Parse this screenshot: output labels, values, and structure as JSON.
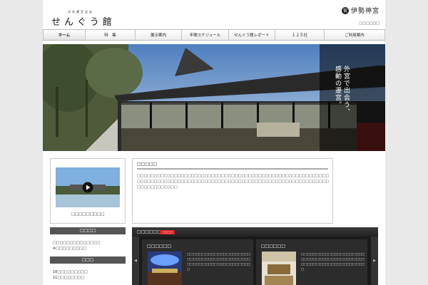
{
  "header": {
    "logo_sub": "式年遷宮記念",
    "logo_main": "せんぐう館",
    "ise_emblem": "宮",
    "ise_logo_text": "伊勢神宮",
    "top_link": "□□□□□□"
  },
  "nav": {
    "items": [
      {
        "label": "ホーム"
      },
      {
        "label": "特　集"
      },
      {
        "label": "展示案内"
      },
      {
        "label": "年間スケジュール"
      },
      {
        "label": "せんぐう館レポート"
      },
      {
        "label": "１２５社"
      },
      {
        "label": "ご利用案内"
      }
    ]
  },
  "hero": {
    "line1": "外宮で出会う、",
    "line2": "感動の遷宮。"
  },
  "video": {
    "caption": "□□□□□□□□□"
  },
  "notice": {
    "title": "□□□□□",
    "body": "□□□□□□□□□□□□□□□□□□□□□□□□□□□□□□□□□□□□□□□□□□□□□□□□□□□□□□□□□□□□□□□□□□□□□□□□□□□□□□□□□□□□□□□□□□□□□□□□□□□□□□□□□□□□□□□□□□□□□□□□□□□□□□"
  },
  "side1": {
    "head": "□□□□",
    "line1": "□□□□□□□□□□□□□□",
    "line2": "※□□□□□□□□□"
  },
  "side2": {
    "head": "□□□",
    "line1": "10□□□□□□□□□",
    "line2": "11□□□□□□□□"
  },
  "pickup": {
    "title": "□□□□□□",
    "badge": "□□□□",
    "prev": "◀",
    "next": "▶",
    "cards": [
      {
        "title": "□□□□□□",
        "text": "□□□□□□□□□□□□□□□□□□□□□□□□□□□□□□□□□□□□□□□□□□□□□□□□□□□□□□□□□□□□□□□□"
      },
      {
        "title": "□□□□□□",
        "text": "□□□□□□□□□□□□□□□□□□□□□□□□□□□□□□□□□□□□□□□□□□□□□□□□□□□□□□□□□□□□□□□□"
      }
    ]
  }
}
